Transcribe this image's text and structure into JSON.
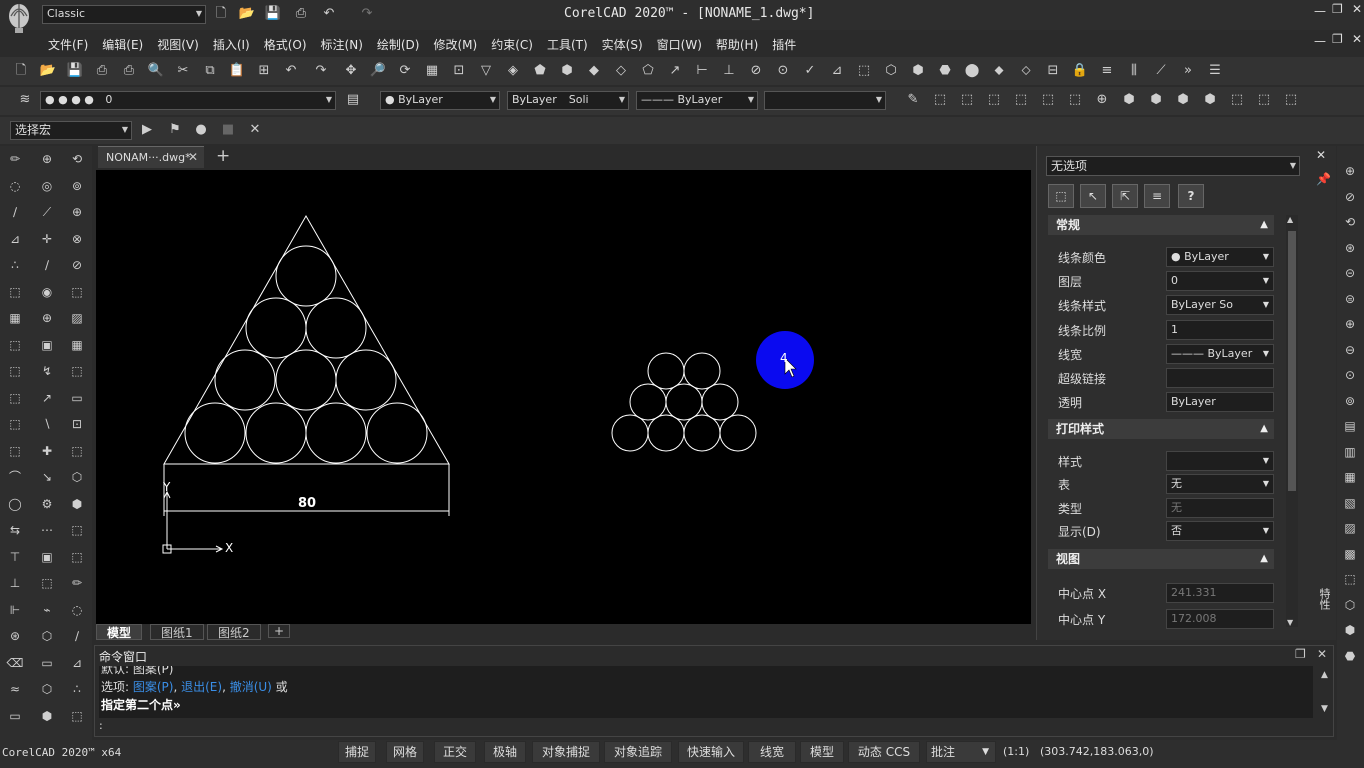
{
  "title": "CorelCAD 2020™ - [NONAME_1.dwg*]",
  "workspace": "Classic",
  "menu": [
    "文件(F)",
    "编辑(E)",
    "视图(V)",
    "插入(I)",
    "格式(O)",
    "标注(N)",
    "绘制(D)",
    "修改(M)",
    "约束(C)",
    "工具(T)",
    "实体(S)",
    "窗口(W)",
    "帮助(H)",
    "插件"
  ],
  "layer_value": "0",
  "color_value": "ByLayer",
  "linestyle_value": "ByLayer",
  "linestyle_suffix": "Soli",
  "lineweight_value": "ByLayer",
  "macro_select": "选择宏",
  "doc_tab": "NONAM···.dwg*",
  "layout_tabs": [
    "模型",
    "图纸1",
    "图纸2"
  ],
  "drawing": {
    "dimension_text": "80",
    "axis_x": "X",
    "axis_y": "Y"
  },
  "cursor_label": "4",
  "properties": {
    "selection": "无选项",
    "help": "?",
    "general_title": "常规",
    "general": [
      {
        "k": "线条颜色",
        "v": "ByLayer",
        "dd": true,
        "dot": true
      },
      {
        "k": "图层",
        "v": "0",
        "dd": true
      },
      {
        "k": "线条样式",
        "v": "ByLayer    So",
        "dd": true
      },
      {
        "k": "线条比例",
        "v": "1"
      },
      {
        "k": "线宽",
        "v": "——— ByLayer",
        "dd": true
      },
      {
        "k": "超级链接",
        "v": ""
      },
      {
        "k": "透明",
        "v": "ByLayer"
      }
    ],
    "print_title": "打印样式",
    "print": [
      {
        "k": "样式",
        "v": "",
        "dd": true
      },
      {
        "k": "表",
        "v": "无",
        "dd": true
      },
      {
        "k": "类型",
        "v": "无",
        "dis": true
      },
      {
        "k": "显示(D)",
        "v": "否",
        "dd": true
      }
    ],
    "view_title": "视图",
    "view": [
      {
        "k": "中心点 X",
        "v": "241.331",
        "dis": true
      },
      {
        "k": "中心点 Y",
        "v": "172.008",
        "dis": true
      }
    ],
    "side_label": "特性"
  },
  "command": {
    "title": "命令窗口",
    "line0": "默认: 图案(P)",
    "options_prefix": "选项: ",
    "opt1": "图案(P)",
    "sep": ", ",
    "opt2": "退出(E)",
    "opt3": "撤消(U)",
    "options_suffix": " 或",
    "prompt": "指定第二个点»",
    "input": ":"
  },
  "status": {
    "app": "CorelCAD 2020™ x64",
    "buttons": [
      "捕捉",
      "网格",
      "正交",
      "极轴",
      "对象捕捉",
      "对象追踪",
      "快速输入",
      "线宽",
      "模型",
      "动态 CCS"
    ],
    "annotation": "批注",
    "scale": "(1:1)",
    "coords": "(303.742,183.063,0)"
  },
  "colors": {
    "canvas": "#000000",
    "accent_circle": "#0a0af0",
    "link": "#3a8ee6"
  }
}
